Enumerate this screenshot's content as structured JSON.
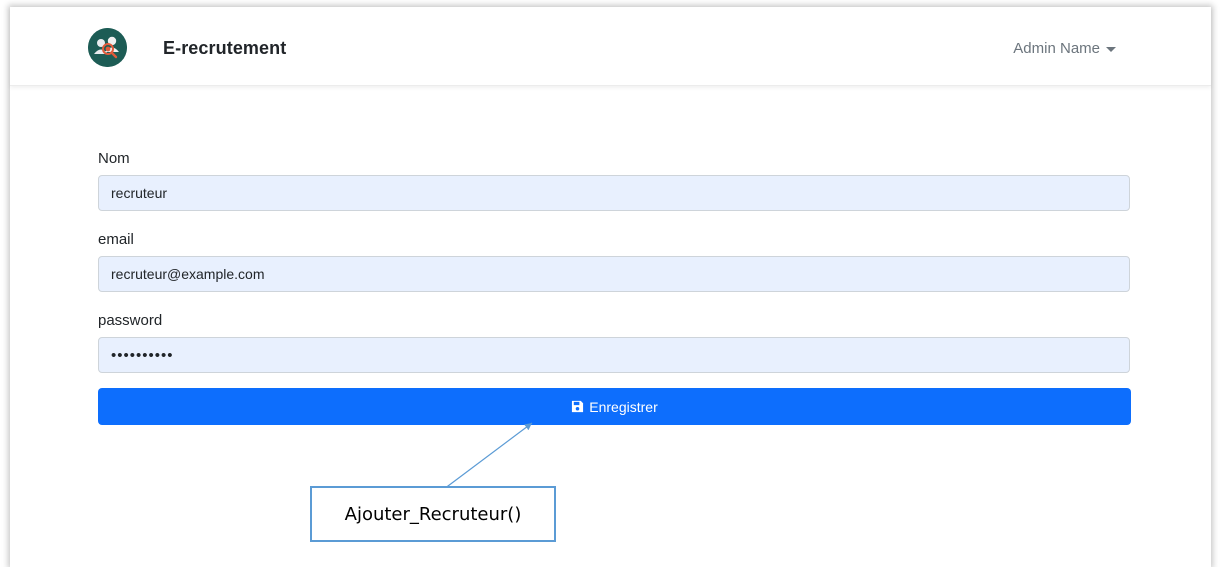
{
  "header": {
    "brand": "E-recrutement",
    "user_name": "Admin Name",
    "logo_icon": "users-search-icon",
    "caret_icon": "caret-down-icon"
  },
  "form": {
    "nom": {
      "label": "Nom",
      "value": "recruteur"
    },
    "email": {
      "label": "email",
      "value": "recruteur@example.com"
    },
    "password": {
      "label": "password",
      "value": "••••••••••"
    },
    "submit": {
      "label": "Enregistrer",
      "icon": "save-icon"
    }
  },
  "annotation": {
    "callout_text": "Ajouter_Recruteur()"
  },
  "colors": {
    "primary": "#0d6efd",
    "input_bg": "#e8f0fe",
    "logo_bg": "#1d5c55",
    "callout_border": "#5b9bd5"
  }
}
